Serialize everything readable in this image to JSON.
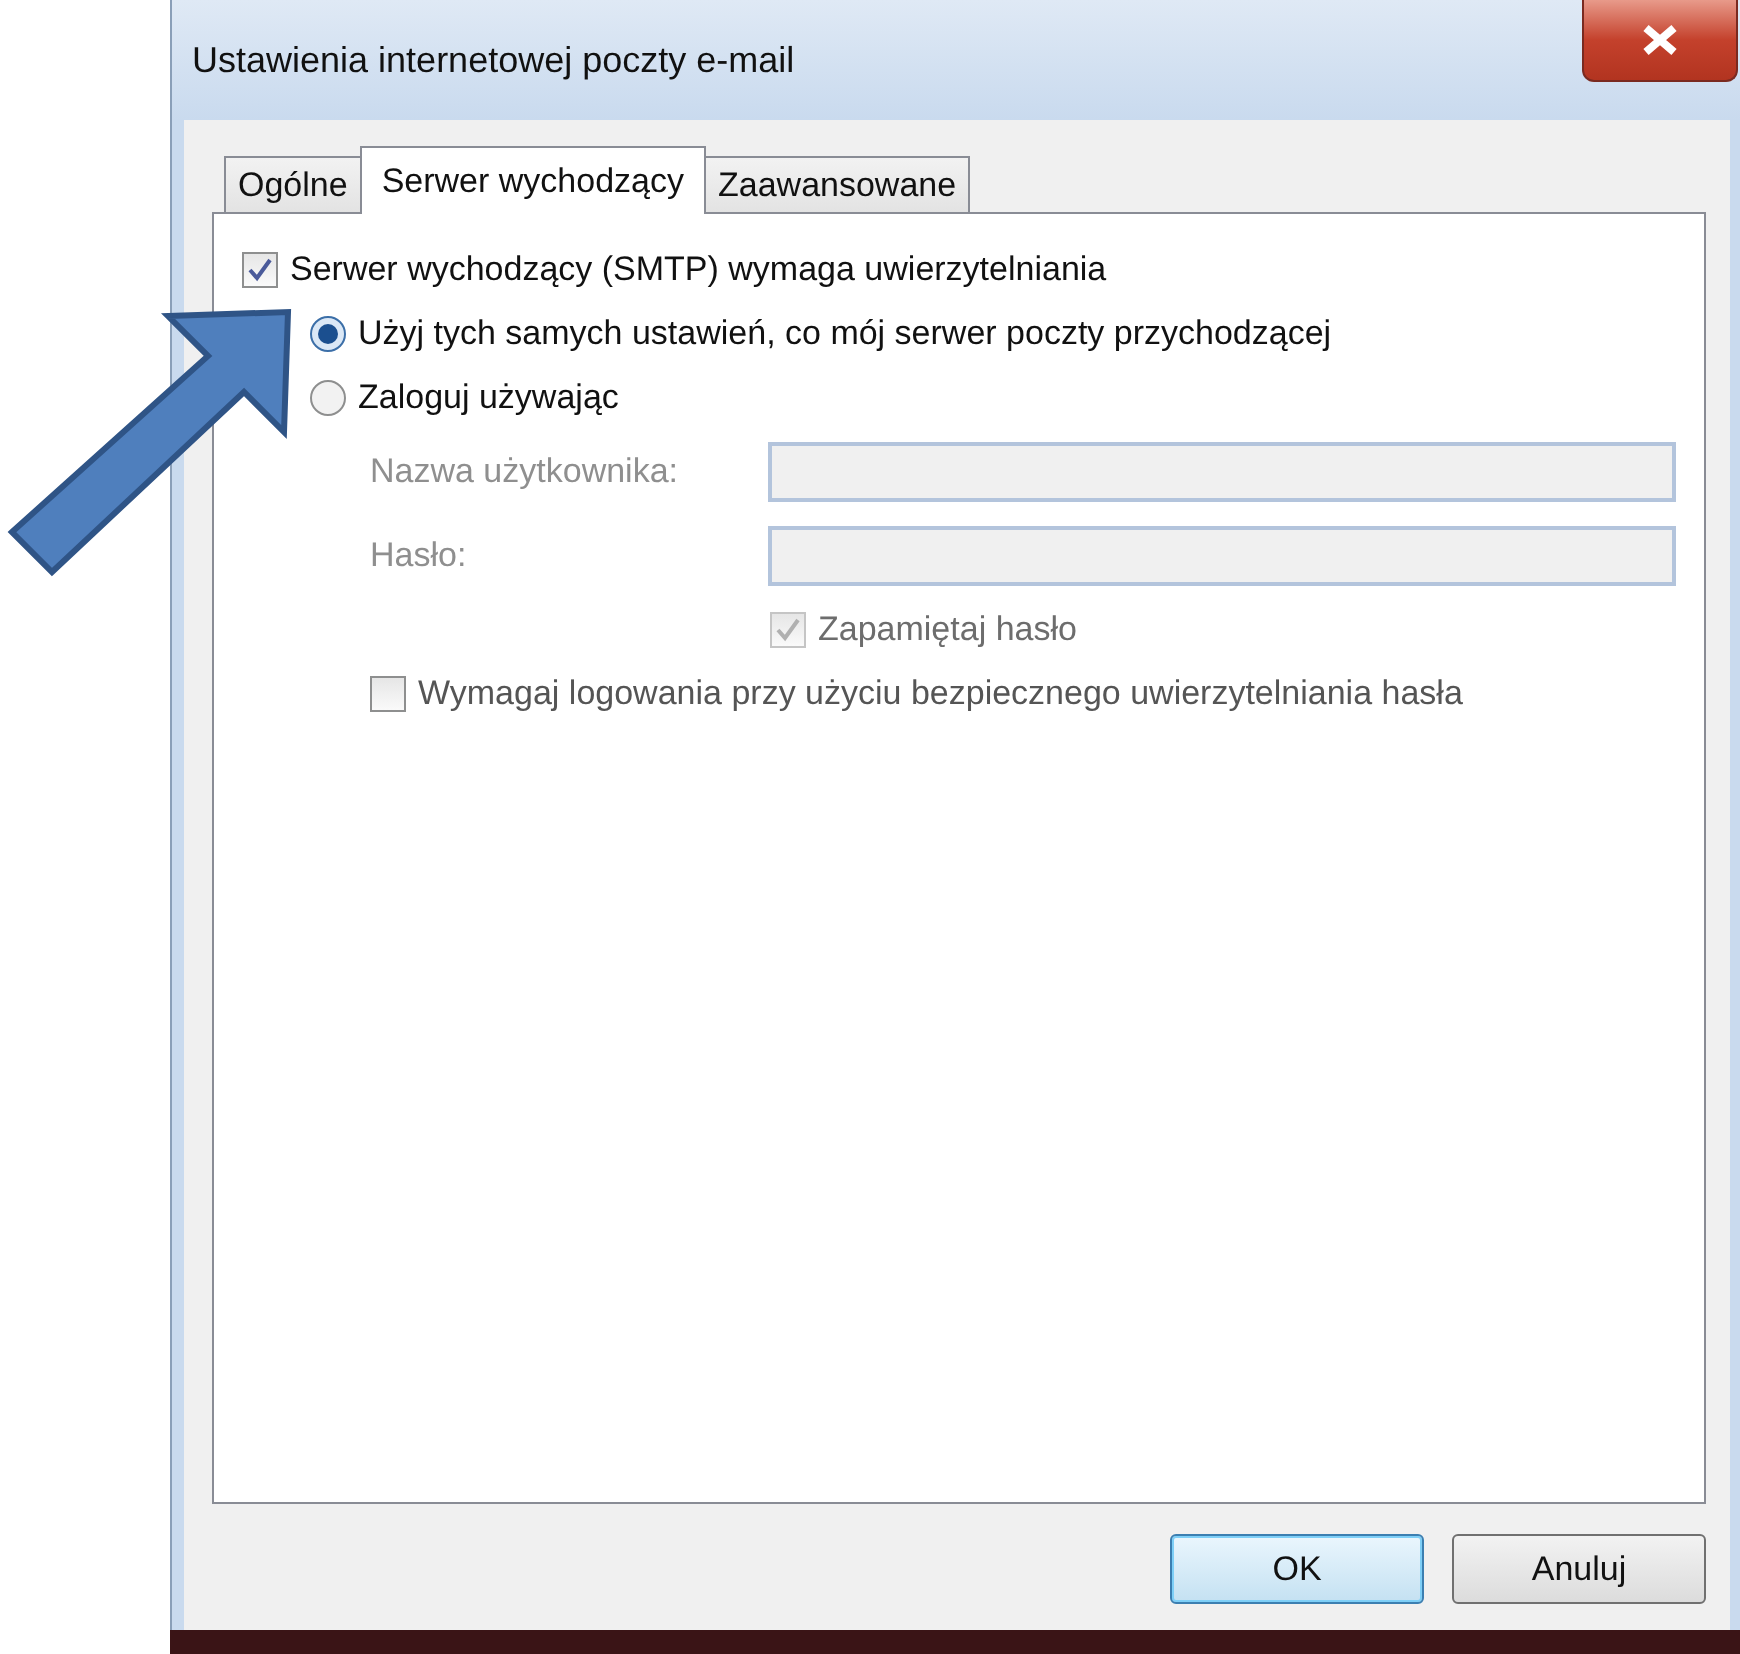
{
  "window": {
    "title": "Ustawienia internetowej poczty e-mail"
  },
  "tabs": [
    {
      "label": "Ogólne",
      "selected": false
    },
    {
      "label": "Serwer wychodzący",
      "selected": true
    },
    {
      "label": "Zaawansowane",
      "selected": false
    }
  ],
  "auth_checkbox": {
    "label": "Serwer wychodzący (SMTP) wymaga uwierzytelniania",
    "checked": true
  },
  "radios": [
    {
      "label": "Użyj tych samych ustawień, co mój serwer poczty przychodzącej",
      "selected": true
    },
    {
      "label": "Zaloguj używając",
      "selected": false
    }
  ],
  "fields": [
    {
      "label": "Nazwa użytkownika:",
      "disabled": true
    },
    {
      "label": "Hasło:",
      "disabled": true
    }
  ],
  "remember_checkbox": {
    "label": "Zapamiętaj hasło",
    "checked": true,
    "disabled": true
  },
  "spa_checkbox": {
    "label": "Wymagaj logowania przy użyciu bezpiecznego uwierzytelniania hasła",
    "checked": false,
    "disabled": false
  },
  "buttons": [
    {
      "label": "OK",
      "default": true
    },
    {
      "label": "Anuluj",
      "default": false
    }
  ]
}
